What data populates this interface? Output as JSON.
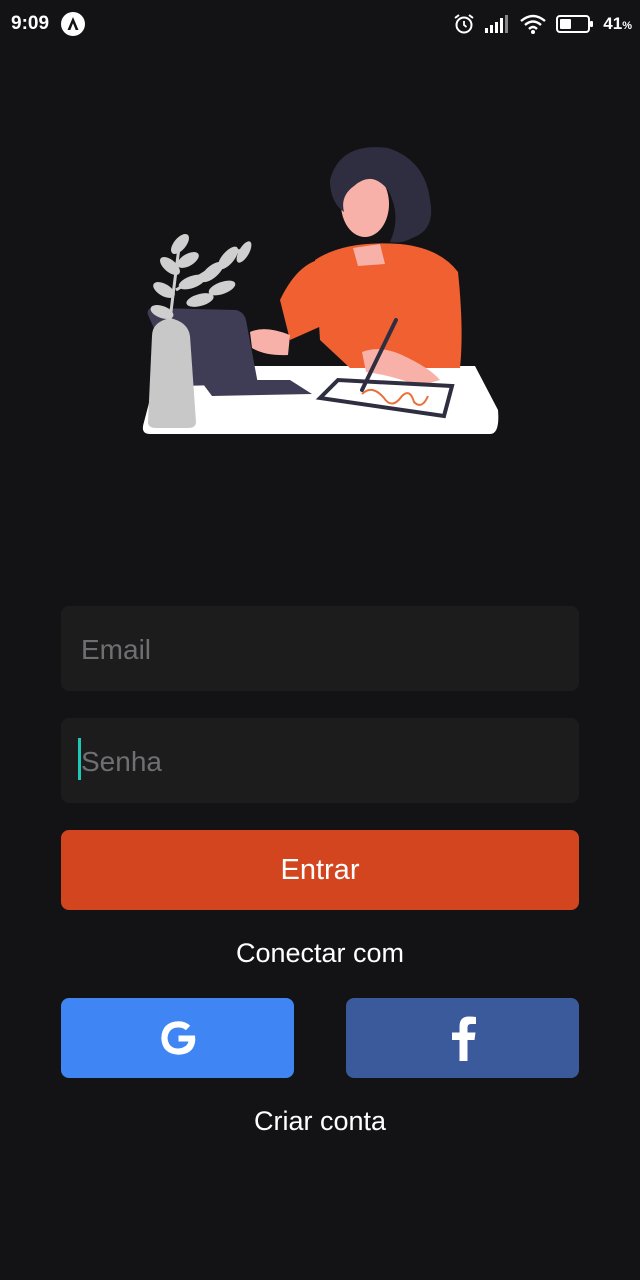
{
  "status_bar": {
    "time": "9:09",
    "battery_percent": "41",
    "battery_unit": "%",
    "icons": [
      "app-notification-icon",
      "alarm-icon",
      "signal-icon",
      "wifi-icon",
      "battery-icon"
    ]
  },
  "login": {
    "email_placeholder": "Email",
    "password_placeholder": "Senha",
    "submit_label": "Entrar",
    "connect_label": "Conectar com",
    "create_account_label": "Criar conta"
  },
  "social": {
    "google_icon": "google-icon",
    "facebook_icon": "facebook-icon"
  },
  "colors": {
    "background": "#131315",
    "field": "#1c1c1d",
    "primary": "#d2451e",
    "google": "#3f85f3",
    "facebook": "#3b5a9c",
    "caret": "#1fc7b6"
  }
}
